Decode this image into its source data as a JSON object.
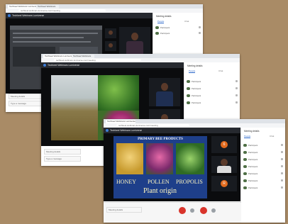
{
  "app": {
    "title": "Techkeel Webinars Lumiverse"
  },
  "browser": {
    "tab1": "Techkeel Webinars Lumiverse",
    "tab2": "Techkeel Webinars",
    "url": "techkeel.webinars.lumiverse.com/meeting"
  },
  "panel": {
    "title": "Meeting details",
    "tab_people": "People",
    "tab_chat": "Chat",
    "participants": [
      "Participant",
      "Participant",
      "Participant",
      "Participant",
      "Participant",
      "Participant",
      "Participant"
    ]
  },
  "bottom": {
    "meeting_details": "Meeting details",
    "chat_placeholder": "Type a message"
  },
  "slide": {
    "heading": "PRIMARY BEE PRODUCTS",
    "caption1": "HONEY",
    "caption2": "POLLEN",
    "caption3": "PROPOLIS",
    "caption4": "Plant origin"
  },
  "tiles": {
    "badge1": "6",
    "badge2": "R",
    "badge3": "R"
  },
  "colors": {
    "background": "#a98b66",
    "stage": "#0b0c0e",
    "slide_bg": "#1e3f8a",
    "accent": "#2a66c9",
    "end_call": "#d9342b"
  }
}
